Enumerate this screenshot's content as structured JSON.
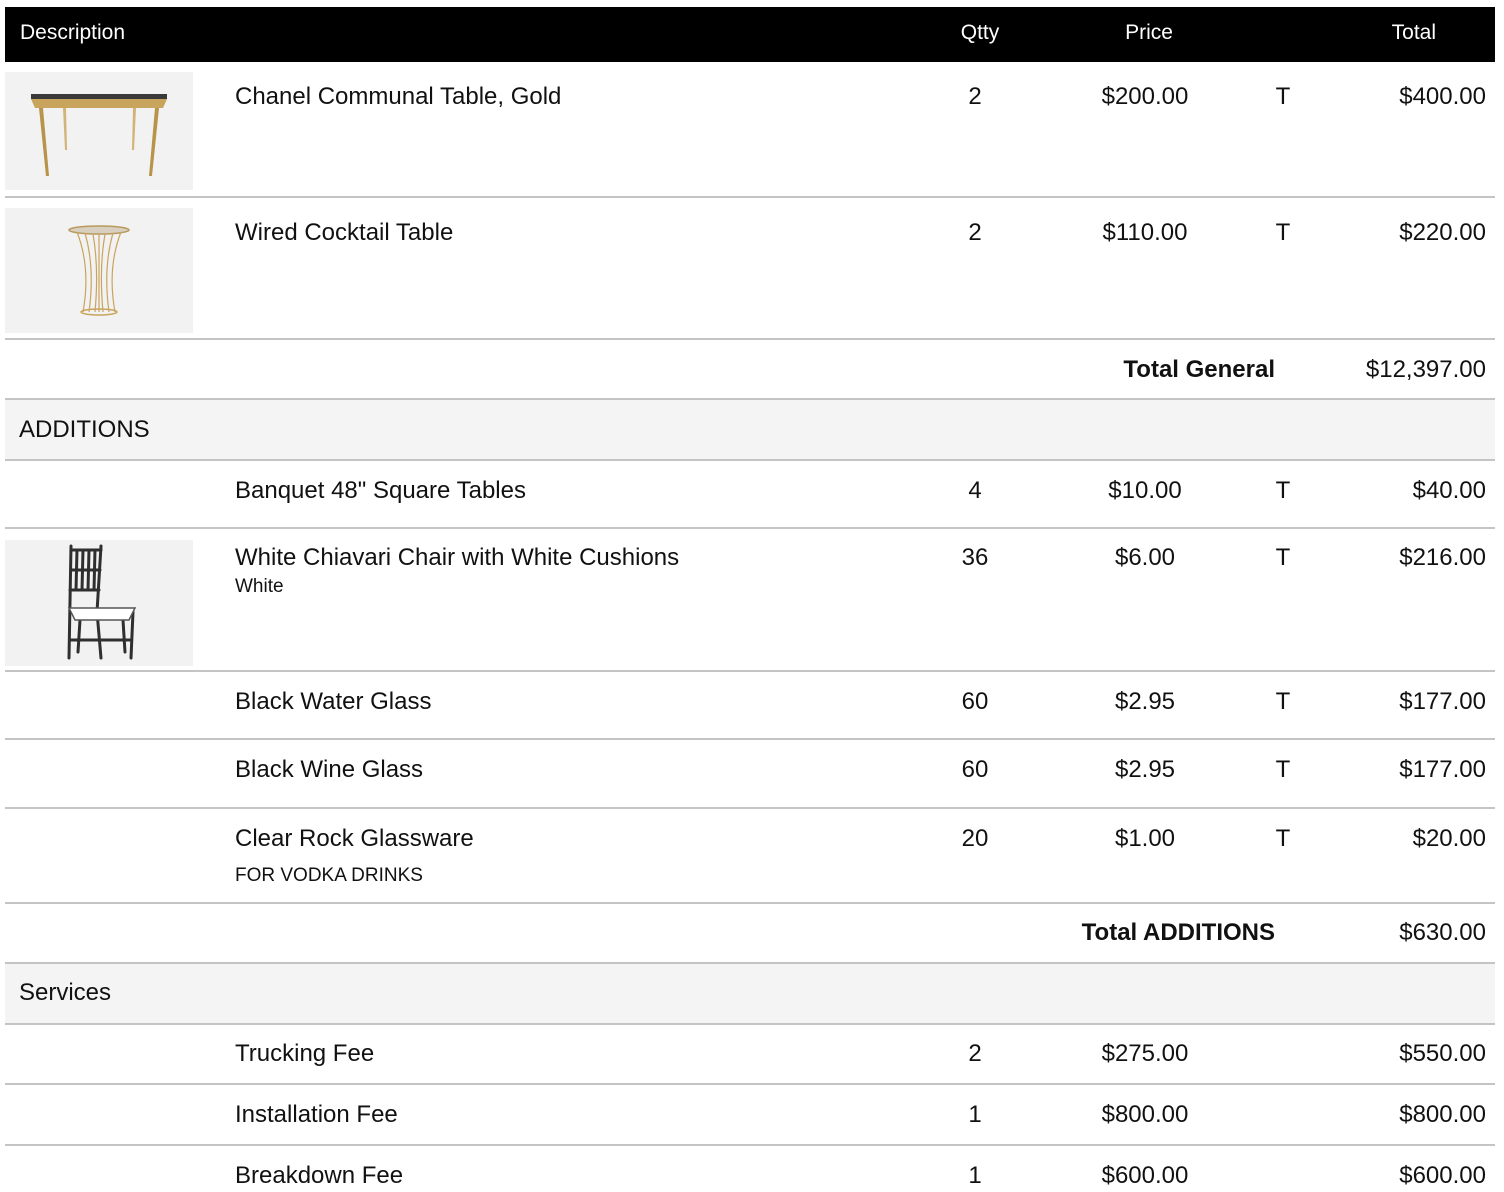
{
  "columns": {
    "description": "Description",
    "qty": "Qtty",
    "price": "Price",
    "total": "Total"
  },
  "general_items": [
    {
      "name": "Chanel Communal Table, Gold",
      "qty": "2",
      "price": "$200.00",
      "tax": "T",
      "total": "$400.00",
      "icon": "gold-console-table-image"
    },
    {
      "name": "Wired Cocktail Table",
      "qty": "2",
      "price": "$110.00",
      "tax": "T",
      "total": "$220.00",
      "icon": "wire-cocktail-table-image"
    }
  ],
  "general_total": {
    "label": "Total General",
    "value": "$12,397.00"
  },
  "additions": {
    "title": "ADDITIONS",
    "items": [
      {
        "name": "Banquet 48\" Square Tables",
        "qty": "4",
        "price": "$10.00",
        "tax": "T",
        "total": "$40.00"
      },
      {
        "name": "White Chiavari Chair with White Cushions",
        "note": "White",
        "qty": "36",
        "price": "$6.00",
        "tax": "T",
        "total": "$216.00",
        "icon": "chiavari-chair-image"
      },
      {
        "name": "Black Water Glass",
        "qty": "60",
        "price": "$2.95",
        "tax": "T",
        "total": "$177.00"
      },
      {
        "name": "Black Wine Glass",
        "qty": "60",
        "price": "$2.95",
        "tax": "T",
        "total": "$177.00"
      },
      {
        "name": "Clear Rock Glassware",
        "note": "FOR VODKA DRINKS",
        "qty": "20",
        "price": "$1.00",
        "tax": "T",
        "total": "$20.00"
      }
    ],
    "total": {
      "label": "Total ADDITIONS",
      "value": "$630.00"
    }
  },
  "services": {
    "title": "Services",
    "items": [
      {
        "name": "Trucking Fee",
        "qty": "2",
        "price": "$275.00",
        "total": "$550.00"
      },
      {
        "name": "Installation Fee",
        "qty": "1",
        "price": "$800.00",
        "total": "$800.00"
      },
      {
        "name": "Breakdown Fee",
        "qty": "1",
        "price": "$600.00",
        "total": "$600.00"
      }
    ]
  }
}
